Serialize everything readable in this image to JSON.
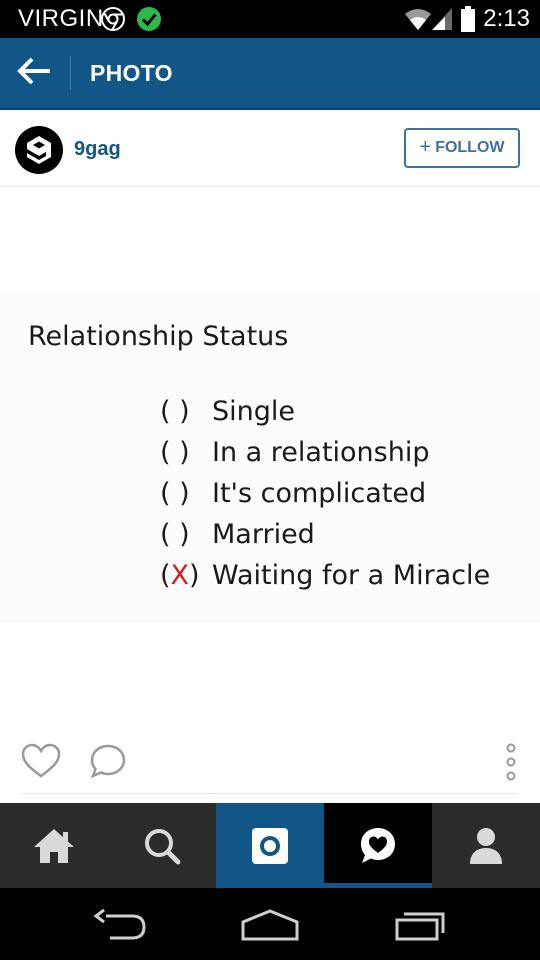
{
  "status_bar": {
    "carrier": "VIRGIN",
    "time": "2:13"
  },
  "header": {
    "title": "PHOTO"
  },
  "post": {
    "username": "9gag",
    "follow_label": "FOLLOW",
    "follow_plus": "+",
    "image": {
      "title": "Relationship Status",
      "options": [
        {
          "mark": "( )",
          "label": "Single",
          "checked": false
        },
        {
          "mark": "( )",
          "label": "In a relationship",
          "checked": false
        },
        {
          "mark": "( )",
          "label": "It's complicated",
          "checked": false
        },
        {
          "mark": "( )",
          "label": "Married",
          "checked": false
        },
        {
          "mark_open": "(",
          "mark_x": "X",
          "mark_close": ")",
          "label": "Waiting for a Miracle",
          "checked": true
        }
      ]
    }
  },
  "tabs": [
    {
      "name": "home",
      "icon": "home-icon"
    },
    {
      "name": "search",
      "icon": "search-icon"
    },
    {
      "name": "camera",
      "icon": "camera-icon"
    },
    {
      "name": "activity",
      "icon": "activity-heart-icon"
    },
    {
      "name": "profile",
      "icon": "profile-icon"
    }
  ],
  "colors": {
    "header_blue": "#125688",
    "follow_blue": "#3f729b",
    "x_red": "#d81a1a",
    "tab_bar": "#2c2c2c"
  }
}
